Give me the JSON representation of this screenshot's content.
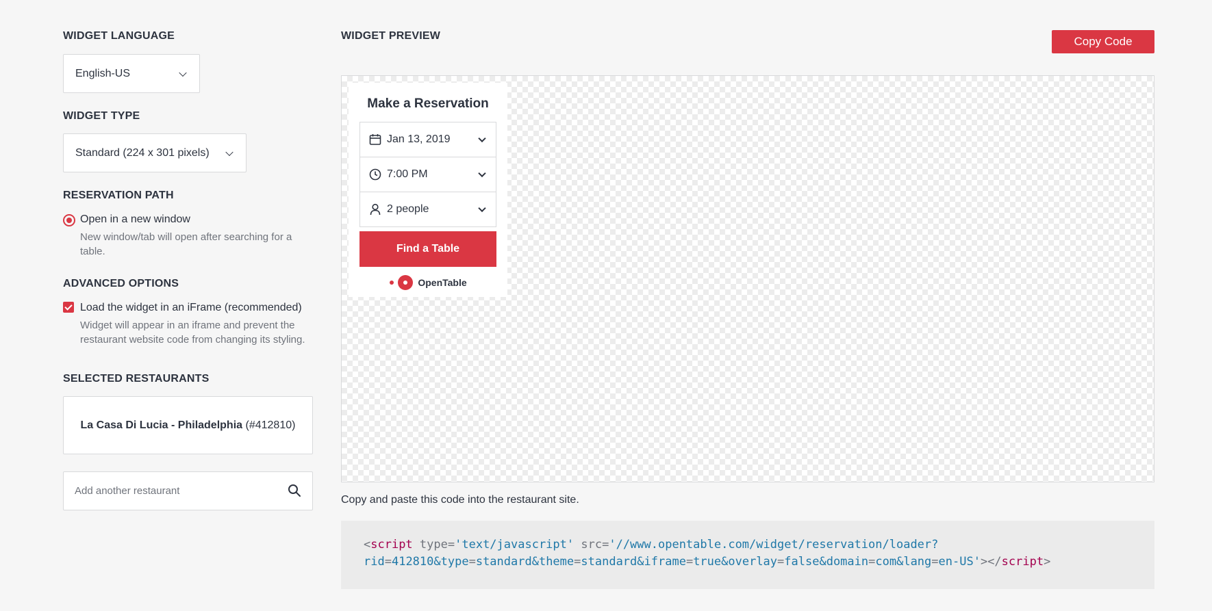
{
  "sidebar": {
    "language": {
      "title": "WIDGET LANGUAGE",
      "value": "English-US"
    },
    "type": {
      "title": "WIDGET TYPE",
      "value": "Standard (224 x 301 pixels)"
    },
    "reservation_path": {
      "title": "RESERVATION PATH",
      "option_label": "Open in a new window",
      "option_desc": "New window/tab will open after searching for a table.",
      "checked": true
    },
    "advanced": {
      "title": "ADVANCED OPTIONS",
      "option_label": "Load the widget in an iFrame (recommended)",
      "option_desc": "Widget will appear in an iframe and prevent the restaurant website code from changing its styling.",
      "checked": true
    },
    "restaurants": {
      "title": "SELECTED RESTAURANTS",
      "selected_name": "La Casa Di Lucia - Philadelphia",
      "selected_id": "(#412810)",
      "search_placeholder": "Add another restaurant"
    }
  },
  "preview": {
    "title": "WIDGET PREVIEW",
    "copy_button": "Copy Code",
    "widget": {
      "title": "Make a Reservation",
      "date": "Jan 13, 2019",
      "time": "7:00 PM",
      "party": "2 people",
      "find_button": "Find a Table",
      "brand": "OpenTable"
    }
  },
  "code": {
    "instructions": "Copy and paste this code into the restaurant site.",
    "tag_open": "script",
    "type_attr": "type",
    "type_val": "'text/javascript'",
    "src_attr": "src",
    "src_val": "'//www.opentable.com/widget/reservation/loader?",
    "q_rid": "rid",
    "q_rid_val": "412810&",
    "q_type": "type",
    "q_type_val": "standard&",
    "q_theme": "theme",
    "q_theme_val": "standard&",
    "q_iframe": "iframe",
    "q_iframe_val": "true&",
    "q_overlay": "overlay",
    "q_overlay_val": "false&",
    "q_domain": "domain",
    "q_domain_val": "com&",
    "q_lang": "lang",
    "q_lang_val": "en-US'",
    "tag_close": "script"
  },
  "colors": {
    "accent": "#da3743",
    "text": "#2d333f",
    "muted": "#6f737b",
    "border": "#d8d9db"
  }
}
